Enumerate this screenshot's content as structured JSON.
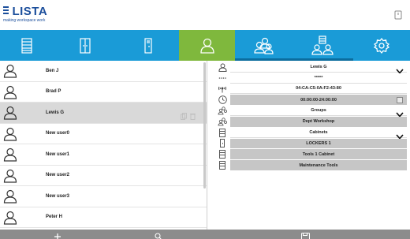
{
  "brand": {
    "name": "LISTA",
    "tagline": "making workspace work"
  },
  "colors": {
    "tab_bar": "#1a9bd7",
    "tab_active": "#7fb83d",
    "brand": "#1c4f9c",
    "bottom_bar": "#8c8c8c"
  },
  "tabs": [
    {
      "icon": "drawer-cabinet-icon"
    },
    {
      "icon": "double-door-cabinet-icon"
    },
    {
      "icon": "locker-icon"
    },
    {
      "icon": "user-icon"
    },
    {
      "icon": "users-group-icon"
    },
    {
      "icon": "cabinet-users-icon"
    },
    {
      "icon": "gear-icon"
    }
  ],
  "users": [
    {
      "name": "Ben J"
    },
    {
      "name": "Brad P"
    },
    {
      "name": "Lewis G"
    },
    {
      "name": "New user0"
    },
    {
      "name": "New user1"
    },
    {
      "name": "New user2"
    },
    {
      "name": "New user3"
    },
    {
      "name": "Peter H"
    }
  ],
  "detail": {
    "name": "Lewis G",
    "pin": "*****",
    "rfid": "04:CA:C5:0A:F2:43:80",
    "time_window": "00:00:00-24:00:00",
    "groups_header": "Groups",
    "groups": [
      "Dept Workshop"
    ],
    "cabinets_header": "Cabinets",
    "cabinets": [
      "LOCKERS 1",
      "Tools 1 Cabinet",
      "Maintenance Tools"
    ]
  },
  "bottom_bar": {
    "add_icon": "plus-icon",
    "search_icon": "search-icon",
    "save_icon": "save-icon"
  }
}
